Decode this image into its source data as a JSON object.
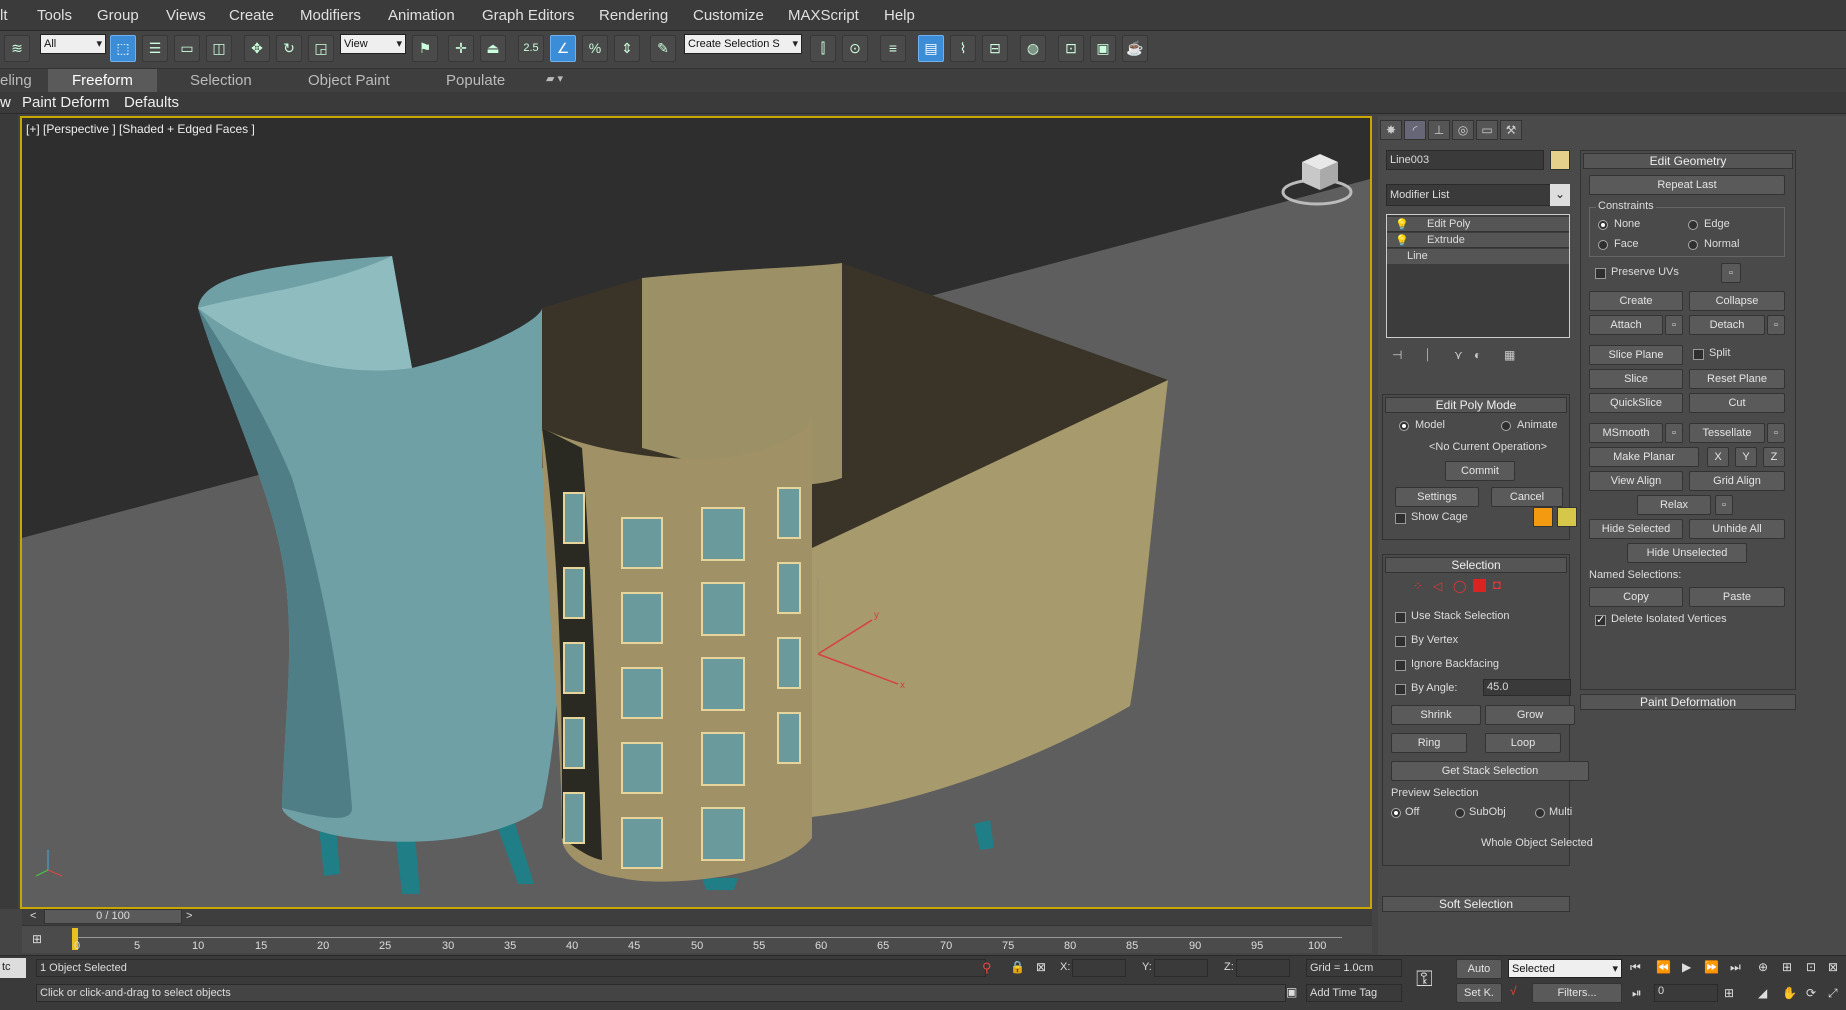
{
  "menu": [
    "lt",
    "Tools",
    "Group",
    "Views",
    "Create",
    "Modifiers",
    "Animation",
    "Graph Editors",
    "Rendering",
    "Customize",
    "MAXScript",
    "Help"
  ],
  "toolbar": {
    "filter": "All",
    "refcoord": "View",
    "snap_value": "2.5",
    "selection_set": "Create Selection S"
  },
  "ribbon": {
    "tabs": [
      "eling",
      "Freeform",
      "Selection",
      "Object Paint",
      "Populate"
    ]
  },
  "subribbon": {
    "items": [
      "w",
      "Paint Deform",
      "Defaults"
    ]
  },
  "viewport": {
    "label": "[+] [Perspective ] [Shaded + Edged Faces ]",
    "gizmo": {
      "x": "x",
      "y": "y"
    }
  },
  "panel": {
    "object_name": "Line003",
    "object_color": "#e4d08a",
    "modifier_list": "Modifier List",
    "stack": [
      "Edit Poly",
      "Extrude",
      "Line"
    ],
    "edit_poly_mode": {
      "title": "Edit Poly Mode",
      "model": "Model",
      "animate": "Animate",
      "operation": "<No Current Operation>",
      "commit": "Commit",
      "settings": "Settings",
      "cancel": "Cancel",
      "show_cage": "Show Cage"
    },
    "selection": {
      "title": "Selection",
      "use_stack": "Use Stack Selection",
      "by_vertex": "By Vertex",
      "ignore_backfacing": "Ignore Backfacing",
      "by_angle": "By Angle:",
      "angle": "45.0",
      "shrink": "Shrink",
      "grow": "Grow",
      "ring": "Ring",
      "loop": "Loop",
      "get_stack": "Get Stack Selection",
      "preview": "Preview Selection",
      "off": "Off",
      "subobj": "SubObj",
      "multi": "Multi",
      "whole": "Whole Object Selected"
    },
    "soft_selection": "Soft Selection",
    "edit_geometry": {
      "title": "Edit Geometry",
      "repeat_last": "Repeat Last",
      "constraints": "Constraints",
      "none": "None",
      "edge": "Edge",
      "face": "Face",
      "normal": "Normal",
      "preserve_uvs": "Preserve UVs",
      "create": "Create",
      "collapse": "Collapse",
      "attach": "Attach",
      "detach": "Detach",
      "slice_plane": "Slice Plane",
      "split": "Split",
      "slice": "Slice",
      "reset_plane": "Reset Plane",
      "quickslice": "QuickSlice",
      "cut": "Cut",
      "msmooth": "MSmooth",
      "tessellate": "Tessellate",
      "make_planar": "Make Planar",
      "x": "X",
      "y": "Y",
      "z": "Z",
      "view_align": "View Align",
      "grid_align": "Grid Align",
      "relax": "Relax",
      "hide_selected": "Hide Selected",
      "unhide_all": "Unhide All",
      "hide_unselected": "Hide Unselected",
      "named_selections": "Named Selections:",
      "copy": "Copy",
      "paste": "Paste",
      "delete_isolated": "Delete Isolated Vertices"
    },
    "paint_deformation": "Paint Deformation"
  },
  "timeline": {
    "frame": "0 / 100",
    "ticks": [
      "0",
      "5",
      "10",
      "15",
      "20",
      "25",
      "30",
      "35",
      "40",
      "45",
      "50",
      "55",
      "60",
      "65",
      "70",
      "75",
      "80",
      "85",
      "90",
      "95",
      "100"
    ]
  },
  "status": {
    "left_tag": "tc",
    "selected": "1 Object Selected",
    "prompt": "Click or click-and-drag to select objects",
    "x_label": "X:",
    "y_label": "Y:",
    "z_label": "Z:",
    "grid": "Grid = 1.0cm",
    "add_time_tag": "Add Time Tag",
    "auto": "Auto",
    "setk": "Set K.",
    "selected_dd": "Selected",
    "filters": "Filters...",
    "frame": "0"
  }
}
